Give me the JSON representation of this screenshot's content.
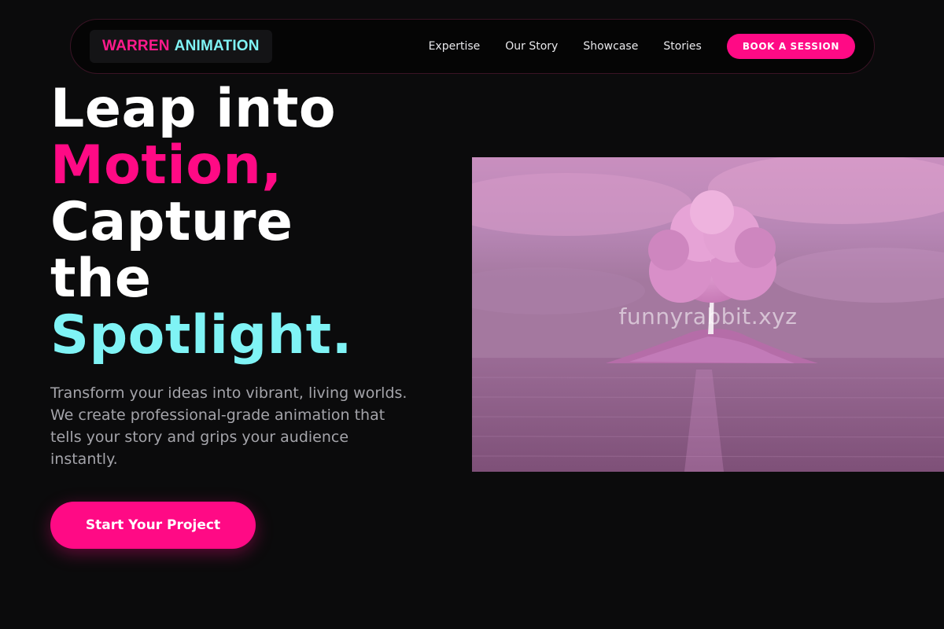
{
  "nav": {
    "logo_part1": "WARREN",
    "logo_part2": "ANIMATION",
    "links": [
      "Expertise",
      "Our Story",
      "Showcase",
      "Stories"
    ],
    "cta_label": "BOOK A SESSION"
  },
  "hero": {
    "headline_line1": "Leap into",
    "headline_line2": "Motion,",
    "headline_line3": "Capture",
    "headline_line4": "the",
    "headline_line5": "Spotlight.",
    "description": "Transform your ideas into vibrant, living worlds. We create professional-grade animation that tells your story and grips your audience instantly.",
    "cta_label": "Start Your Project"
  },
  "image": {
    "watermark": "funnyrabbit.xyz",
    "subject": "pink-tree-on-island-in-water"
  },
  "colors": {
    "background": "#0b0b0c",
    "accent_pink": "#ff0a85",
    "accent_cyan": "#7ff3f5",
    "body_text": "#a4a4aa"
  }
}
